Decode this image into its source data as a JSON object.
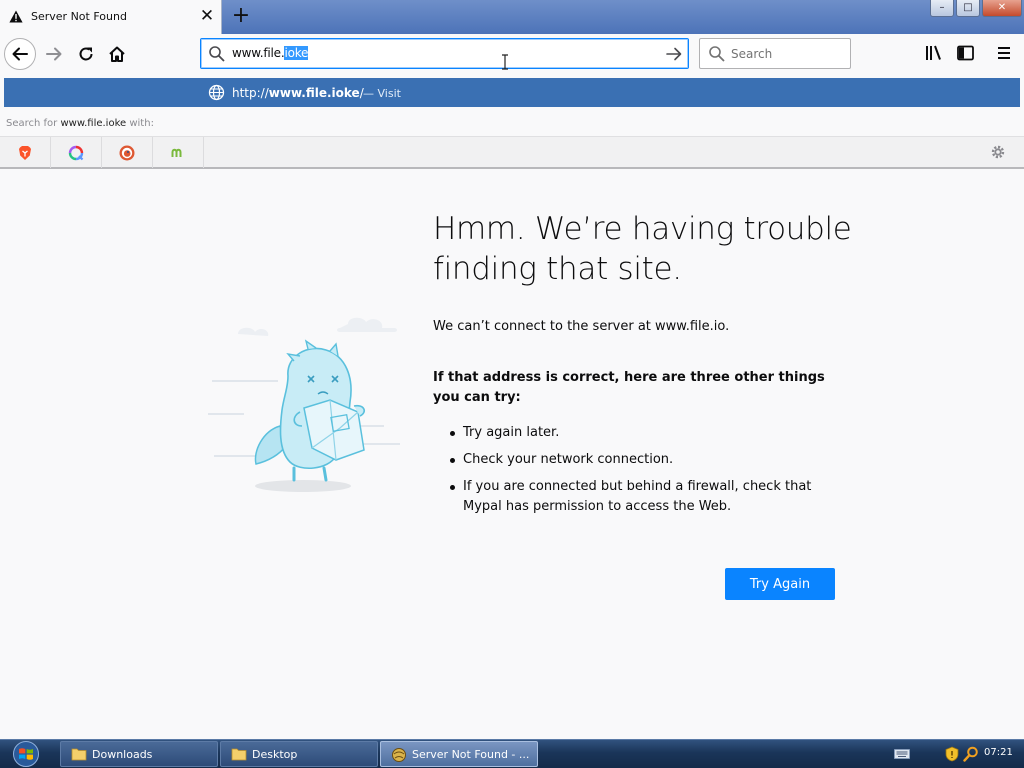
{
  "tab": {
    "title": "Server Not Found",
    "close_glyph": "✕"
  },
  "tabstrip": {
    "new_tab_glyph": "+"
  },
  "window_controls": {
    "minimize": "–",
    "restore": "□",
    "close": "✕"
  },
  "urlbar": {
    "value_prefix": "www.file.",
    "value_selected": "ioke"
  },
  "searchbar": {
    "placeholder": "Search"
  },
  "url_dropdown": {
    "url_scheme": "http://",
    "url_host": "www.file.ioke",
    "url_suffix": "/",
    "action": "— Visit",
    "search_for_prefix": "Search for ",
    "search_term": "www.file.ioke",
    "search_for_suffix": " with:",
    "engines": [
      "brave-icon",
      "qwant-icon",
      "duckduckgo-icon",
      "mojeek-icon"
    ]
  },
  "error_page": {
    "title": "Hmm. We’re having trouble finding that site.",
    "short_desc": "We can’t connect to the server at www.file.io.",
    "try_intro": "If that address is correct, here are three other things you can try:",
    "suggestions": [
      "Try again later.",
      "Check your network connection.",
      "If you are connected but behind a firewall, check that Mypal has permission to access the Web."
    ],
    "button": "Try Again"
  },
  "taskbar": {
    "tasks": [
      {
        "label": "Downloads",
        "icon": "folder-icon"
      },
      {
        "label": "Desktop",
        "icon": "folder-icon"
      },
      {
        "label": "Server Not Found - ...",
        "icon": "browser-icon"
      }
    ],
    "clock": "07:21"
  },
  "colors": {
    "accent": "#0a84ff",
    "dropdown_highlight": "#3a70b3",
    "taskbar": "#1a3559"
  }
}
